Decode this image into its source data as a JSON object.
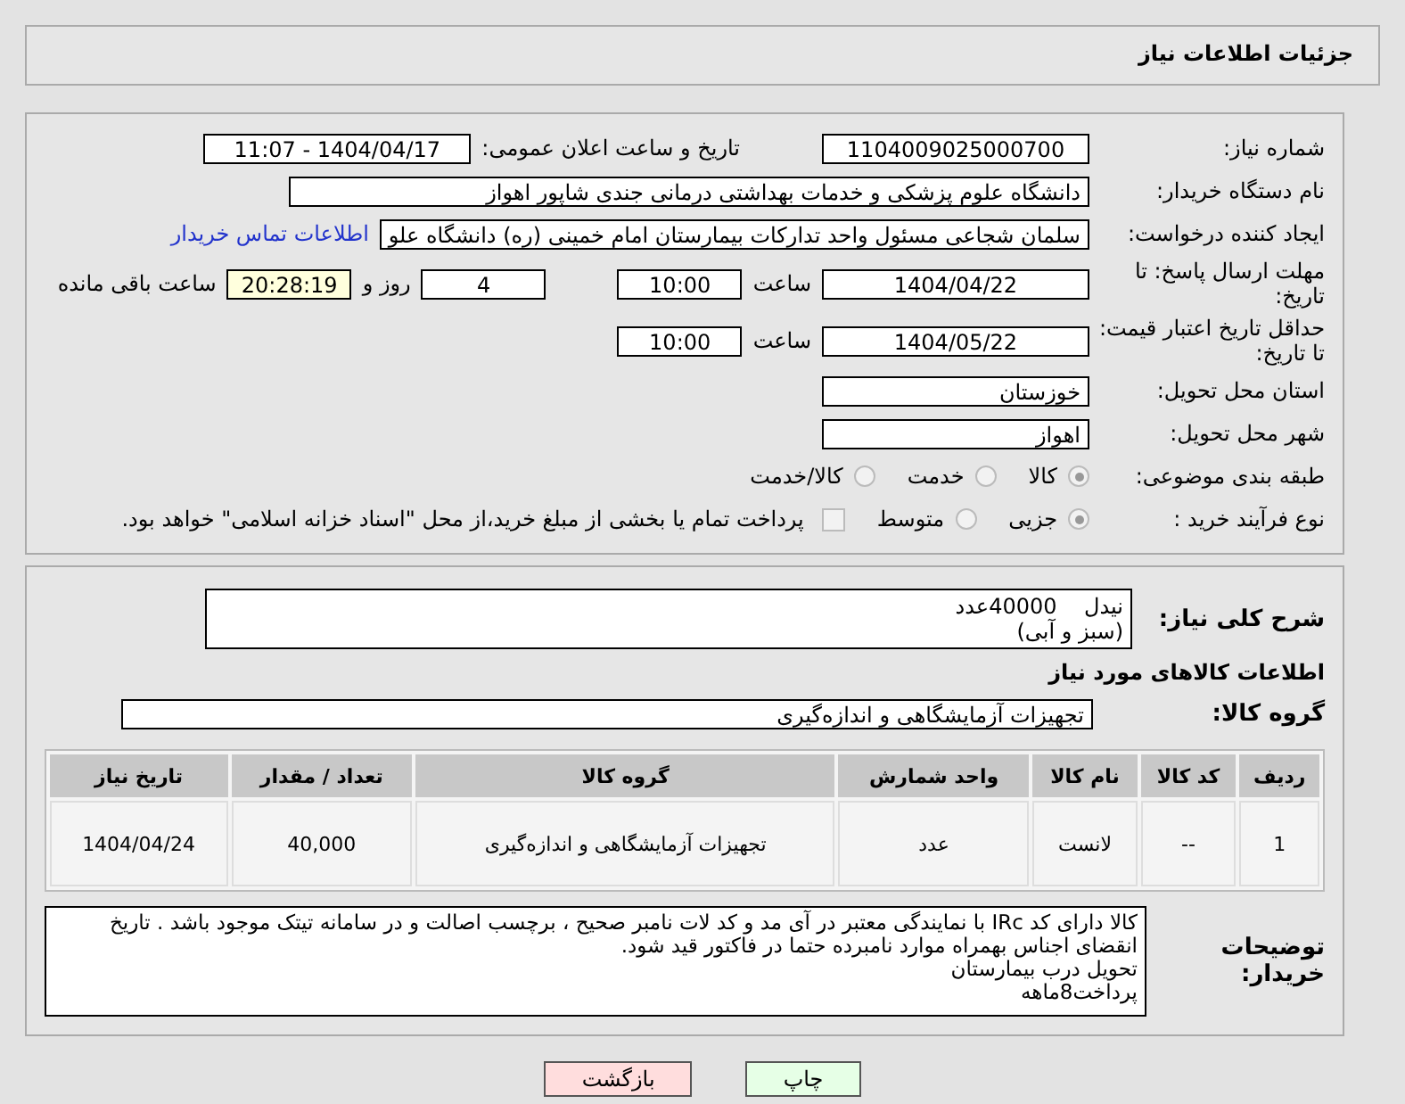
{
  "title": "جزئیات اطلاعات نیاز",
  "need_number": {
    "label": "شماره نیاز:",
    "value": "1104009025000700"
  },
  "announce": {
    "label": "تاریخ و ساعت اعلان عمومی:",
    "value": "1404/04/17 - 11:07"
  },
  "buyer": {
    "label": "نام دستگاه خریدار:",
    "value": "دانشگاه علوم پزشکی و خدمات بهداشتی درمانی جندی شاپور اهواز"
  },
  "requester": {
    "label": "ایجاد کننده درخواست:",
    "value": "سلمان شجاعی مسئول واحد تدارکات بیمارستان امام خمینی (ره) دانشگاه علو",
    "link": "اطلاعات تماس خریدار"
  },
  "deadline": {
    "label": "مهلت ارسال پاسخ: تا تاریخ:",
    "date": "1404/04/22",
    "time_label": "ساعت",
    "time": "10:00",
    "days": "4",
    "days_label": "روز و",
    "remaining": "20:28:19",
    "remaining_label": "ساعت باقی مانده"
  },
  "validity": {
    "label": "حداقل تاریخ اعتبار قیمت: تا تاریخ:",
    "date": "1404/05/22",
    "time_label": "ساعت",
    "time": "10:00"
  },
  "province": {
    "label": "استان محل تحویل:",
    "value": "خوزستان"
  },
  "city": {
    "label": "شهر محل تحویل:",
    "value": "اهواز"
  },
  "category": {
    "label": "طبقه بندی موضوعی:",
    "options": [
      {
        "label": "کالا",
        "selected": true
      },
      {
        "label": "خدمت",
        "selected": false
      },
      {
        "label": "کالا/خدمت",
        "selected": false
      }
    ]
  },
  "process": {
    "label": "نوع فرآیند خرید :",
    "options": [
      {
        "label": "جزیی",
        "selected": true
      },
      {
        "label": "متوسط",
        "selected": false
      }
    ],
    "payment": {
      "label": "پرداخت تمام یا بخشی از مبلغ خرید،از محل \"اسناد خزانه اسلامی\" خواهد بود.",
      "checked": false
    }
  },
  "description": {
    "label": "شرح کلی نیاز:",
    "value": "نیدل    40000عدد\n(سبز و آبی)"
  },
  "goods_title": "اطلاعات کالاهای مورد نیاز",
  "goods_group": {
    "label": "گروه کالا:",
    "value": "تجهیزات آزمایشگاهی و اندازه‌گیری"
  },
  "table": {
    "columns": [
      "ردیف",
      "کد کالا",
      "نام کالا",
      "واحد شمارش",
      "گروه کالا",
      "تعداد / مقدار",
      "تاریخ نیاز"
    ],
    "rows": [
      [
        "1",
        "--",
        "لانست",
        "عدد",
        "تجهیزات آزمایشگاهی و اندازه‌گیری",
        "40,000",
        "1404/04/24"
      ]
    ]
  },
  "notes": {
    "label": "توضیحات خریدار:",
    "value": "کالا دارای کد IRc با نمایندگی معتبر در آی مد و کد لات نامبر صحیح ، برچسب اصالت و در سامانه تیتک موجود باشد . تاریخ انقضای اجناس بهمراه موارد نامبرده حتما در فاکتور قید شود.\nتحویل درب بیمارستان\nپرداخت8ماهه"
  },
  "buttons": [
    {
      "label": "چاپ",
      "kind": "print"
    },
    {
      "label": "بازگشت",
      "kind": "back"
    }
  ]
}
